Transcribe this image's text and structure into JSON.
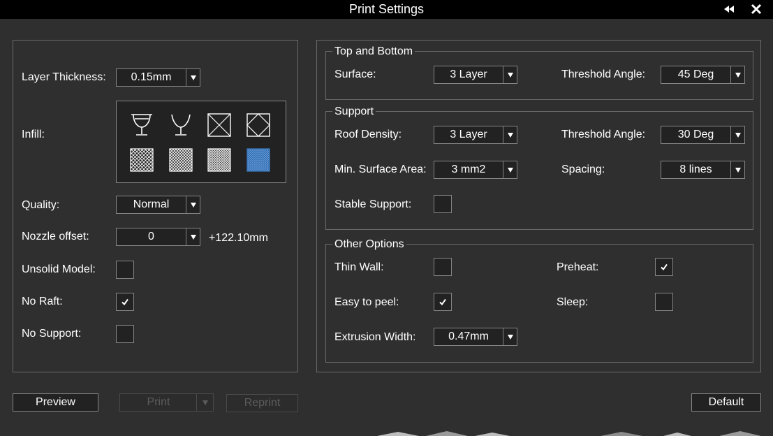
{
  "window": {
    "title": "Print Settings",
    "back_icon": "double-left-arrow-icon",
    "close_icon": "close-icon"
  },
  "left": {
    "layer_thickness": {
      "label": "Layer Thickness:",
      "value": "0.15mm"
    },
    "infill": {
      "label": "Infill:",
      "patterns": [
        "hollow-goblet-icon",
        "open-goblet-icon",
        "x-grid-icon",
        "diamond-grid-icon",
        "sparse-mesh-icon",
        "medium-mesh-icon",
        "dense-mesh-icon",
        "solid-mesh-icon"
      ],
      "selected_index": 7
    },
    "quality": {
      "label": "Quality:",
      "value": "Normal"
    },
    "nozzle_offset": {
      "label": "Nozzle offset:",
      "value": "0",
      "readout": "+122.10mm"
    },
    "unsolid_model": {
      "label": "Unsolid Model:",
      "checked": false
    },
    "no_raft": {
      "label": "No Raft:",
      "checked": true
    },
    "no_support": {
      "label": "No Support:",
      "checked": false
    }
  },
  "top_bottom": {
    "legend": "Top and Bottom",
    "surface": {
      "label": "Surface:",
      "value": "3 Layer"
    },
    "threshold_angle": {
      "label": "Threshold Angle:",
      "value": "45 Deg"
    }
  },
  "support": {
    "legend": "Support",
    "roof_density": {
      "label": "Roof Density:",
      "value": "3 Layer"
    },
    "threshold_angle": {
      "label": "Threshold Angle:",
      "value": "30 Deg"
    },
    "min_surface_area": {
      "label": "Min. Surface Area:",
      "value": "3 mm2"
    },
    "spacing": {
      "label": "Spacing:",
      "value": "8 lines"
    },
    "stable_support": {
      "label": "Stable Support:",
      "checked": false
    }
  },
  "other": {
    "legend": "Other Options",
    "thin_wall": {
      "label": "Thin Wall:",
      "checked": false
    },
    "preheat": {
      "label": "Preheat:",
      "checked": true
    },
    "easy_to_peel": {
      "label": "Easy to peel:",
      "checked": true
    },
    "sleep": {
      "label": "Sleep:",
      "checked": false
    },
    "extrusion_width": {
      "label": "Extrusion Width:",
      "value": "0.47mm"
    }
  },
  "buttons": {
    "preview": "Preview",
    "print": "Print",
    "reprint": "Reprint",
    "default": "Default"
  },
  "colors": {
    "background": "#2f2f2f",
    "titlebar": "#000000",
    "border": "#858585",
    "accent": "#1f5fa8",
    "disabled_text": "#5c5c5c"
  }
}
